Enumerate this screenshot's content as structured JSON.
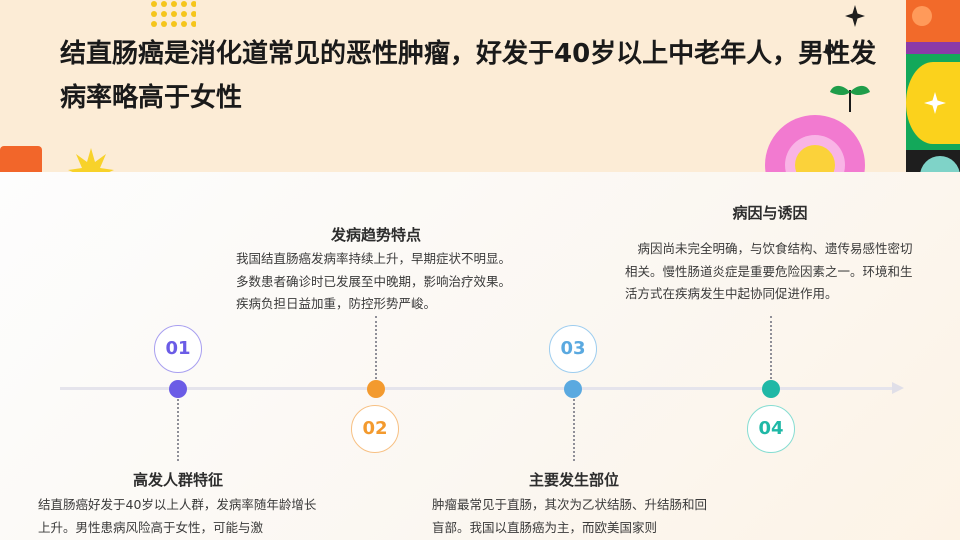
{
  "title": "结直肠癌是消化道常见的恶性肿瘤，好发于40岁以上中老年人，男性发病率略高于女性",
  "colors": {
    "purple": "#6b5ce6",
    "orange": "#f39a2e",
    "blue": "#5aa9e0",
    "teal": "#1fb8a6"
  },
  "milestones": [
    {
      "number": "01",
      "heading": "高发人群特征",
      "text": "结直肠癌好发于40岁以上人群，发病率随年龄增长上升。男性患病风险高于女性，可能与激"
    },
    {
      "number": "02",
      "heading": "发病趋势特点",
      "text": "我国结直肠癌发病率持续上升，早期症状不明显。多数患者确诊时已发展至中晚期，影响治疗效果。疾病负担日益加重，防控形势严峻。"
    },
    {
      "number": "03",
      "heading": "主要发生部位",
      "text": "肿瘤最常见于直肠，其次为乙状结肠、升结肠和回盲部。我国以直肠癌为主，而欧美国家则"
    },
    {
      "number": "04",
      "heading": "病因与诱因",
      "text": "病因尚未完全明确，与饮食结构、遗传易感性密切相关。慢性肠道炎症是重要危险因素之一。环境和生活方式在疾病发生中起协同促进作用。"
    }
  ]
}
